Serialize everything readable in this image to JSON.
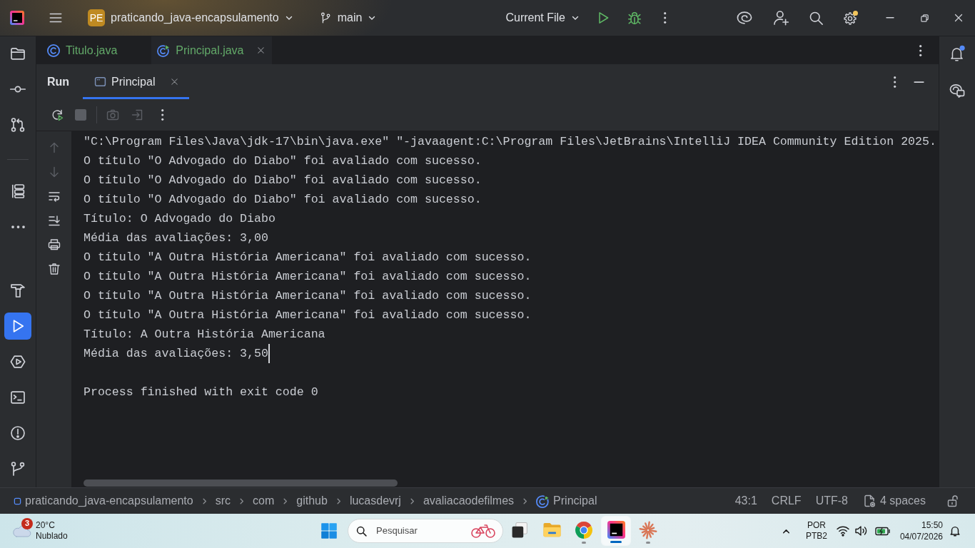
{
  "title_bar": {
    "project": {
      "badge": "PE",
      "name": "praticando_java-encapsulamento"
    },
    "branch": "main",
    "run_configuration": "Current File",
    "settings": {
      "update_available": true
    }
  },
  "left_stripe": {
    "top_groups": [
      [
        {
          "kind": "project",
          "selected": false
        },
        {
          "kind": "commit",
          "selected": false
        },
        {
          "kind": "pull_requests",
          "selected": false
        }
      ],
      [
        {
          "kind": "structure",
          "selected": false
        },
        {
          "kind": "more",
          "selected": false
        }
      ]
    ],
    "bottom": [
      {
        "kind": "build",
        "selected": false
      },
      {
        "kind": "run",
        "selected": true
      },
      {
        "kind": "services",
        "selected": false
      },
      {
        "kind": "terminal",
        "selected": false
      },
      {
        "kind": "problems",
        "selected": false
      },
      {
        "kind": "git",
        "selected": false
      }
    ]
  },
  "editor_tabs": [
    {
      "kind": "class",
      "label": "Titulo.java",
      "selected": false
    },
    {
      "kind": "runnable_class",
      "label": "Principal.java",
      "selected": true
    }
  ],
  "run_panel": {
    "title": "Run",
    "tabs": [
      {
        "label": "Principal",
        "selected": true
      }
    ],
    "toolbar": [
      [
        {
          "kind": "rerun",
          "disabled": false
        },
        {
          "kind": "stop",
          "disabled": true
        }
      ],
      [
        {
          "kind": "screenshot",
          "disabled": true
        },
        {
          "kind": "attach",
          "disabled": true
        },
        {
          "kind": "more",
          "disabled": false
        }
      ]
    ],
    "gutter": [
      {
        "kind": "previous",
        "disabled": true
      },
      {
        "kind": "next",
        "disabled": true
      },
      {
        "kind": "soft_wrap",
        "disabled": false
      },
      {
        "kind": "scroll_to_end",
        "disabled": false
      },
      {
        "kind": "print",
        "disabled": false
      },
      {
        "kind": "clear",
        "disabled": false
      }
    ],
    "console": {
      "command": "\"C:\\Program Files\\Java\\jdk-17\\bin\\java.exe\" \"-javaagent:C:\\Program Files\\JetBrains\\IntelliJ IDEA Community Edition 2025.",
      "output": [
        {
          "text": "O título \"O Advogado do Diabo\" foi avaliado com sucesso.",
          "caret": false
        },
        {
          "text": "O título \"O Advogado do Diabo\" foi avaliado com sucesso.",
          "caret": false
        },
        {
          "text": "O título \"O Advogado do Diabo\" foi avaliado com sucesso.",
          "caret": false
        },
        {
          "text": "Título: O Advogado do Diabo",
          "caret": false
        },
        {
          "text": "Média das avaliações: 3,00",
          "caret": false
        },
        {
          "text": "O título \"A Outra História Americana\" foi avaliado com sucesso.",
          "caret": false
        },
        {
          "text": "O título \"A Outra História Americana\" foi avaliado com sucesso.",
          "caret": false
        },
        {
          "text": "O título \"A Outra História Americana\" foi avaliado com sucesso.",
          "caret": false
        },
        {
          "text": "O título \"A Outra História Americana\" foi avaliado com sucesso.",
          "caret": false
        },
        {
          "text": "Título: A Outra História Americana",
          "caret": false
        },
        {
          "text": "Média das avaliações: 3,50",
          "caret": true
        }
      ],
      "exit_message": "Process finished with exit code 0"
    }
  },
  "right_stripe": {
    "notifications": {
      "unread": true
    }
  },
  "status_bar": {
    "breadcrumbs": [
      {
        "kind": "module",
        "label": "praticando_java-encapsulamento"
      },
      {
        "kind": "directory",
        "label": "src"
      },
      {
        "kind": "directory",
        "label": "com"
      },
      {
        "kind": "directory",
        "label": "github"
      },
      {
        "kind": "directory",
        "label": "lucasdevrj"
      },
      {
        "kind": "directory",
        "label": "avaliacaodefilmes"
      },
      {
        "kind": "runnable_class",
        "label": "Principal"
      }
    ],
    "caret_position": "43:1",
    "line_separator": "CRLF",
    "encoding": "UTF-8",
    "indent": "4 spaces"
  },
  "taskbar": {
    "weather": {
      "badge": "3",
      "temperature": "20°C",
      "condition": "Nublado"
    },
    "search": {
      "placeholder": "Pesquisar"
    },
    "apps": [
      {
        "kind": "task_view",
        "selected": false,
        "running": false
      },
      {
        "kind": "file_explorer",
        "selected": false,
        "running": false
      },
      {
        "kind": "browser",
        "selected": false,
        "running": true
      },
      {
        "kind": "ide",
        "selected": true,
        "running": true
      },
      {
        "kind": "ai_assistant",
        "selected": false,
        "running": true
      }
    ],
    "input_language": "POR",
    "keyboard_layout": "PTB2",
    "time": "15:50",
    "date": "04/07/2026"
  }
}
